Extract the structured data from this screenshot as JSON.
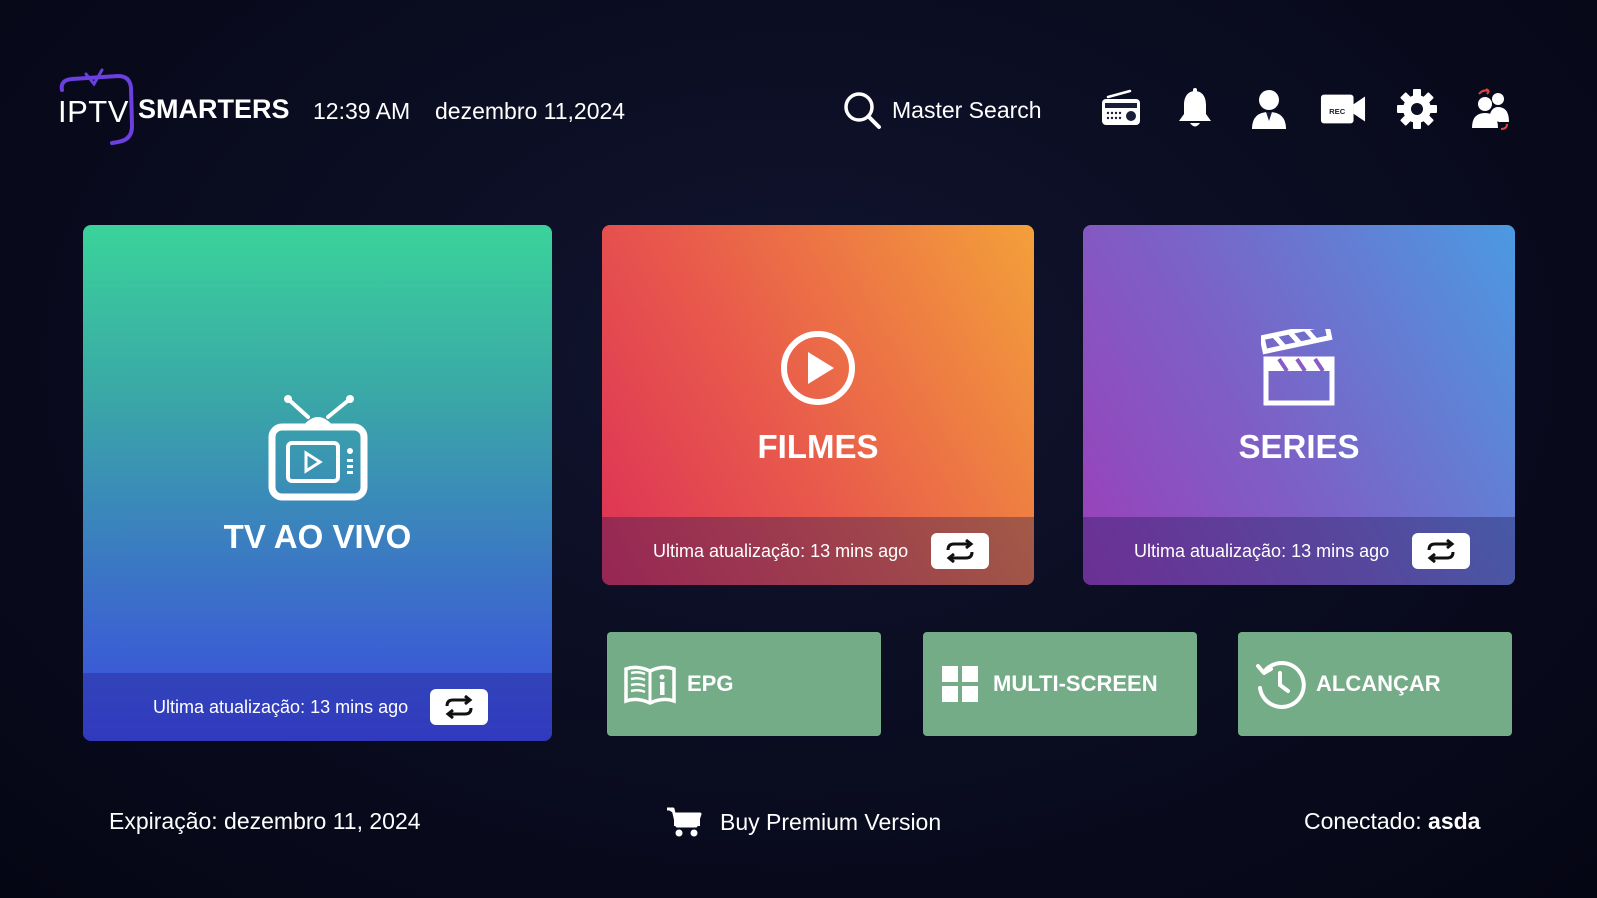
{
  "app": {
    "logo_iptv": "IPTV",
    "logo_smarters": "SMARTERS",
    "time": "12:39 AM",
    "date": "dezembro 11,2024"
  },
  "header": {
    "search_label": "Master Search",
    "icons": [
      "radio-icon",
      "bell-icon",
      "profile-icon",
      "rec-camera-icon",
      "gear-icon",
      "switch-user-icon"
    ],
    "rec_text": "REC"
  },
  "tiles": {
    "live": {
      "title": "TV AO VIVO",
      "updated": "Ultima atualização: 13 mins ago"
    },
    "movies": {
      "title": "FILMES",
      "updated": "Ultima atualização: 13 mins ago"
    },
    "series": {
      "title": "SERIES",
      "updated": "Ultima atualização: 13 mins ago"
    }
  },
  "small_tiles": {
    "epg": "EPG",
    "multi": "MULTI-SCREEN",
    "catchup": "ALCANÇAR"
  },
  "footer": {
    "expiration": "Expiração: dezembro 11, 2024",
    "buy": "Buy Premium Version",
    "connected_label": "Conectado:",
    "connected_user": "asda"
  },
  "colors": {
    "accent_logo": "#6b3fe0",
    "small_tile": "#75ac88"
  }
}
